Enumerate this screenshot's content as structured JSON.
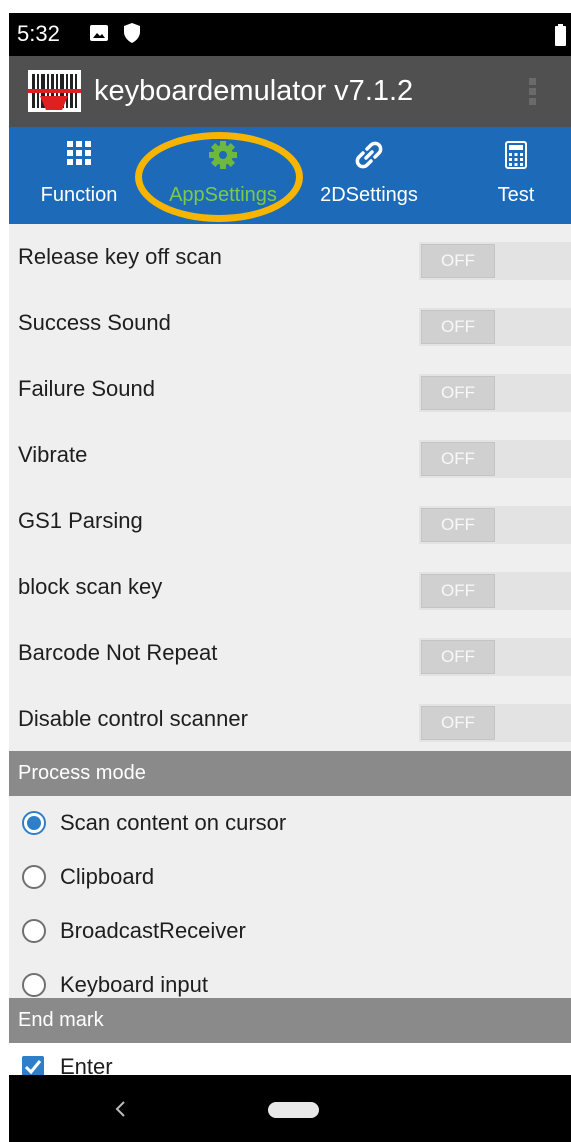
{
  "status_bar": {
    "time": "5:32",
    "icons": [
      "image-icon",
      "shield-icon",
      "battery-icon"
    ]
  },
  "app_bar": {
    "title": "keyboardemulator v7.1.2",
    "icons": [
      "barcode-logo-icon",
      "overflow-menu-icon"
    ],
    "background": "#505050"
  },
  "tabs": {
    "items": [
      {
        "label": "Function",
        "icon": "grid-icon"
      },
      {
        "label": "AppSettings",
        "icon": "gear-icon"
      },
      {
        "label": "2DSettings",
        "icon": "link-icon"
      },
      {
        "label": "Test",
        "icon": "calculator-icon"
      }
    ],
    "active": "AppSettings",
    "background": "#1d6ab9",
    "active_color": "#7cc84d",
    "highlight_color": "#f7b500"
  },
  "toggle_settings": [
    {
      "label": "Release key off scan",
      "state": "OFF"
    },
    {
      "label": "Success Sound",
      "state": "OFF"
    },
    {
      "label": "Failure Sound",
      "state": "OFF"
    },
    {
      "label": "Vibrate",
      "state": "OFF"
    },
    {
      "label": "GS1 Parsing",
      "state": "OFF"
    },
    {
      "label": "block scan key",
      "state": "OFF"
    },
    {
      "label": "Barcode Not Repeat",
      "state": "OFF"
    },
    {
      "label": "Disable control scanner",
      "state": "OFF"
    }
  ],
  "process_mode": {
    "header": "Process mode",
    "options": [
      {
        "label": "Scan content on cursor",
        "checked": true
      },
      {
        "label": "Clipboard",
        "checked": false
      },
      {
        "label": "BroadcastReceiver",
        "checked": false
      },
      {
        "label": "Keyboard input",
        "checked": false
      }
    ],
    "accent": "#2e7fc9"
  },
  "end_mark": {
    "header": "End mark",
    "options": [
      {
        "label": "Enter",
        "checked": true
      }
    ]
  },
  "nav_bar": {
    "icons": [
      "back-icon",
      "home-pill-icon"
    ]
  }
}
